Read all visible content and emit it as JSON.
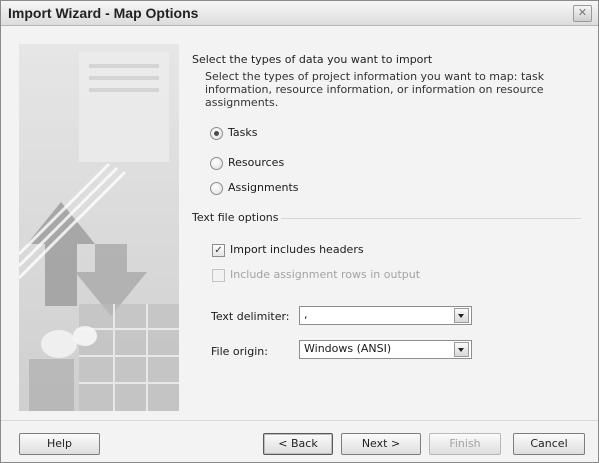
{
  "window": {
    "title": "Import Wizard - Map Options",
    "close_glyph": "✕"
  },
  "data_types": {
    "heading": "Select the types of data you want to import",
    "description": "Select the types of project information you want to map: task information, resource information, or information on resource assignments.",
    "options": [
      {
        "label": "Tasks",
        "selected": true
      },
      {
        "label": "Resources",
        "selected": false
      },
      {
        "label": "Assignments",
        "selected": false
      }
    ]
  },
  "text_file_options": {
    "heading": "Text file options",
    "import_headers": {
      "label": "Import includes headers",
      "checked": true,
      "check_glyph": "✓"
    },
    "include_assignment_rows": {
      "label": "Include assignment rows in output",
      "checked": false,
      "disabled": true
    },
    "delimiter": {
      "label": "Text delimiter:",
      "value": ","
    },
    "file_origin": {
      "label": "File origin:",
      "value": "Windows (ANSI)"
    }
  },
  "buttons": {
    "help": "Help",
    "back": "< Back",
    "next": "Next >",
    "finish": "Finish",
    "cancel": "Cancel"
  },
  "icons": {
    "close": "close-icon",
    "dropdown": "chevron-down-icon"
  }
}
